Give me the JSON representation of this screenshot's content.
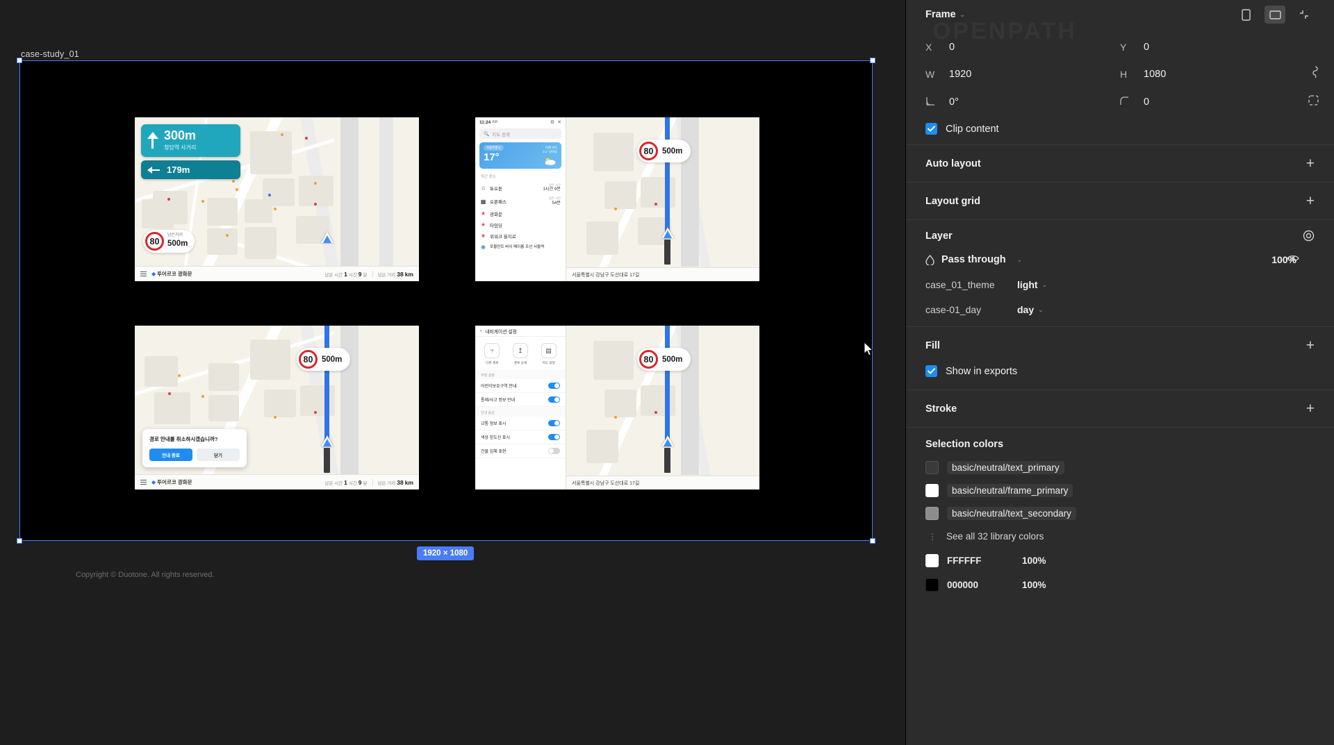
{
  "canvas": {
    "frame_label": "case-study_01",
    "size_pill": "1920 × 1080",
    "copyright": "Copyright © Duotone. All rights reserved.",
    "watermark": "OPENPATH"
  },
  "panel": {
    "header": {
      "title": "Frame",
      "chevron": "⌄"
    },
    "position": {
      "x_key": "X",
      "x_val": "0",
      "y_key": "Y",
      "y_val": "0",
      "w_key": "W",
      "w_val": "1920",
      "h_key": "H",
      "h_val": "1080",
      "rotation_val": "0°",
      "corner_val": "0"
    },
    "clip_content": "Clip content",
    "auto_layout": "Auto layout",
    "layout_grid": "Layout grid",
    "layer": {
      "title": "Layer",
      "blend_mode": "Pass through",
      "opacity": "100%",
      "props": [
        {
          "key": "case_01_theme",
          "value": "light"
        },
        {
          "key": "case-01_day",
          "value": "day"
        }
      ]
    },
    "fill": {
      "title": "Fill",
      "show_in_exports": "Show in exports"
    },
    "stroke": {
      "title": "Stroke"
    },
    "selection_colors": {
      "title": "Selection colors",
      "items": [
        {
          "name": "basic/neutral/text_primary",
          "color": "#3a3a3a"
        },
        {
          "name": "basic/neutral/frame_primary",
          "color": "#ffffff"
        },
        {
          "name": "basic/neutral/text_secondary",
          "color": "#8c8c8c"
        }
      ],
      "see_all": "See all 32 library colors",
      "hex_items": [
        {
          "name": "FFFFFF",
          "opacity": "100%",
          "color": "#ffffff"
        },
        {
          "name": "000000",
          "opacity": "100%",
          "color": "#000000"
        }
      ]
    }
  },
  "maps": {
    "nav_card": {
      "distance": "300m",
      "place": "청담역 사거리",
      "secondary_distance": "179m"
    },
    "speed_badge_detail": {
      "limit": "80",
      "label": "남은거리",
      "value": "500m"
    },
    "speed_badge_simple": {
      "limit": "80",
      "value": "500m"
    },
    "bottom_bar": {
      "destination": "투어르코 광화문",
      "time_label": "남은 시간",
      "time_hour": "1",
      "time_hour_unit": "시간",
      "time_min": "9",
      "time_min_unit": "분",
      "dist_label": "남은 거리",
      "dist_value": "38",
      "dist_unit": "km"
    },
    "address_bar": "서울특별시 강남구 도산대로 17길",
    "dialog": {
      "message": "경로 안내를 취소하시겠습니까?",
      "primary": "안내 종료",
      "secondary": "닫기"
    },
    "phone_search": {
      "time": "11:24",
      "ampm": "AM",
      "search_placeholder": "지도 검색",
      "weather": {
        "chip": "서울특별시",
        "temp": "17°",
        "right_top": "어제 보다",
        "right_bot": "2.1° 낮아요"
      },
      "recent_title": "최근 장소",
      "places": [
        {
          "icon": "home",
          "name": "듀오톤",
          "meta_top": "남은 시간",
          "meta_bot": "1시간 9분"
        },
        {
          "icon": "chart",
          "name": "오픈패스",
          "meta_top": "남은 시간",
          "meta_bot": "54분"
        },
        {
          "icon": "star",
          "name": "광화문",
          "meta_top": "",
          "meta_bot": ""
        },
        {
          "icon": "star",
          "name": "타임딩",
          "meta_top": "",
          "meta_bot": ""
        },
        {
          "icon": "star",
          "name": "위워크 을지로",
          "meta_top": "",
          "meta_bot": ""
        },
        {
          "icon": "pin",
          "name": "포뮬런트 바이 페이롱 조선 서울역",
          "meta_top": "",
          "meta_bot": ""
        }
      ]
    },
    "phone_settings": {
      "title": "내비게이션 설정",
      "quick": [
        {
          "icon": "route",
          "label": "다른 경로"
        },
        {
          "icon": "detail",
          "label": "경로 상세"
        },
        {
          "icon": "map",
          "label": "지도 설정"
        }
      ],
      "group_1": "주행 설정",
      "rows_1": [
        {
          "label": "어린이보호구역 안내",
          "on": true
        },
        {
          "label": "통제/사고 정보 안내",
          "on": true
        }
      ],
      "group_2": "안내 음성",
      "rows_2": [
        {
          "label": "교통 정보 표시",
          "on": true
        },
        {
          "label": "색상 믿도선 표시",
          "on": true
        },
        {
          "label": "건물 입체 표현",
          "on": false
        }
      ]
    }
  }
}
